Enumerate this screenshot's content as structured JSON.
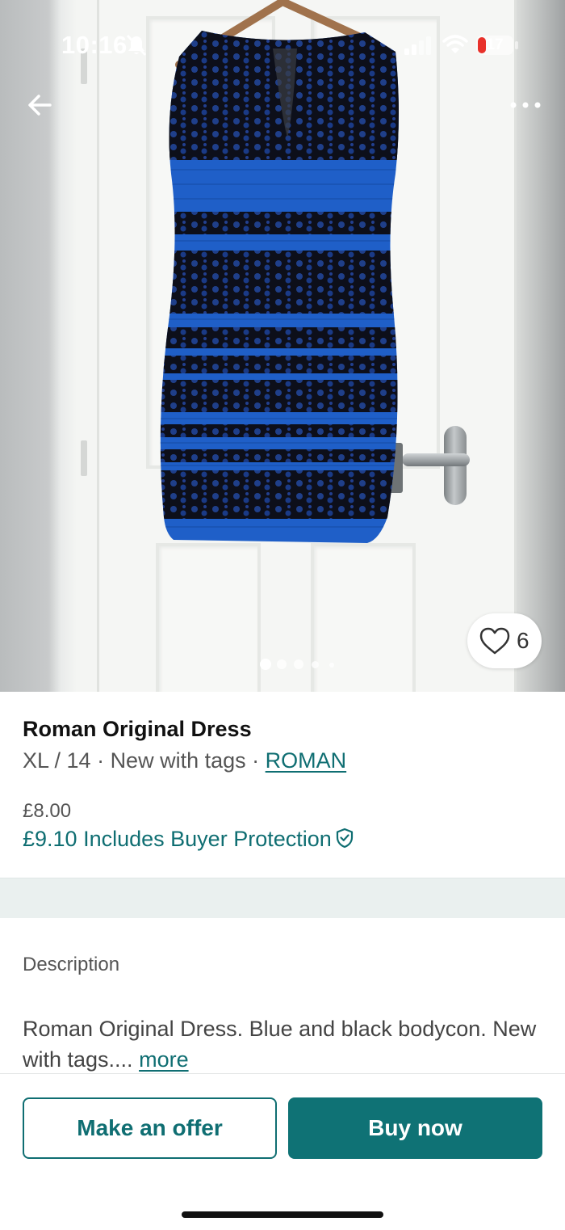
{
  "status_bar": {
    "time": "10:16",
    "battery_level": "17",
    "battery_color": "#e8312a"
  },
  "photo": {
    "alt": "Blue and black lace bodycon dress on a hanger against a white door",
    "favourite_count": "6",
    "page_count": 5,
    "active_page": 1,
    "dress_colors": {
      "blue": "#1f5fc8",
      "black": "#0d0f1a"
    }
  },
  "listing": {
    "title": "Roman Original Dress",
    "size": "XL / 14",
    "condition": "New with tags",
    "brand": "ROMAN",
    "price": "£8.00",
    "protected_price": "£9.10",
    "protection_label": "Includes Buyer Protection"
  },
  "description": {
    "label": "Description",
    "text": "Roman Original Dress. Blue and black bodycon. New with tags....",
    "more_link": "more"
  },
  "actions": {
    "offer_label": "Make an offer",
    "buy_label": "Buy now"
  },
  "icons": {
    "back": "arrow-left-icon",
    "more": "more-horizontal-icon",
    "favourite": "heart-icon",
    "shield": "shield-check-icon",
    "bell": "bell-slash-icon",
    "wifi": "wifi-icon",
    "signal": "signal-icon"
  },
  "colors": {
    "accent": "#0f6e72",
    "band": "#eaf0ef"
  }
}
